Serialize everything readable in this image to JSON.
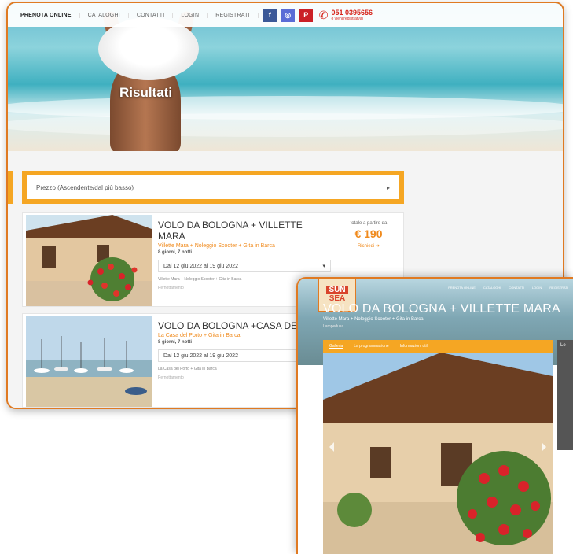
{
  "back_window": {
    "nav_items": [
      "PRENOTA ONLINE",
      "CATALOGHI",
      "CONTATTI",
      "LOGIN",
      "REGISTRATI"
    ],
    "social_icons": [
      {
        "name": "facebook-icon",
        "glyph": "f",
        "color": "#3b5998"
      },
      {
        "name": "instagram-icon",
        "glyph": "◎",
        "color": "#5b6cd6"
      },
      {
        "name": "pinterest-icon",
        "glyph": "P",
        "color": "#cb2027"
      }
    ],
    "phone_number": "051 0395656",
    "phone_note": "o vieni/registrati/al",
    "hero_title": "Risultati",
    "sort_select": "Prezzo (Ascendente/dal più basso)",
    "accent_color": "#f5a623",
    "results": [
      {
        "title": "VOLO DA BOLOGNA + VILLETTE MARA",
        "subtitle": "Villette Mara + Noleggio Scooter + Gita in Barca",
        "duration": "8 giorni, 7 notti",
        "date": "Dal 12 giu 2022 al 19 giu 2022",
        "description": "Villette Mara + Noleggio Scooter + Gita in Barca",
        "footer": "Pernottamento",
        "price_label": "totale a partire da",
        "price": "€ 190",
        "price_link": "Richiedi"
      },
      {
        "title": "VOLO DA BOLOGNA +CASA DEL P",
        "subtitle": "La Casa del Porto + Gita in Barca",
        "duration": "8 giorni, 7 notti",
        "date": "Dal 12 giu 2022 al 19 giu 2022",
        "description": "La Casa del Porto + Gita in Barca",
        "footer": "Pernottamento"
      }
    ]
  },
  "front_window": {
    "logo_top": "SUN",
    "logo_bottom": "SEA",
    "nav_items": [
      "PRENOTA ONLINE",
      "CATALOGHI",
      "CONTATTI",
      "LOGIN",
      "REGISTRATI"
    ],
    "title": "VOLO DA BOLOGNA + VILLETTE MARA",
    "subtitle": "Villette Mara + Noleggio Scooter + Gita in Barca",
    "location": "Lampedusa",
    "tabs": [
      "Galleria",
      "La programmazione",
      "Informazioni utili"
    ],
    "side_label": "Le"
  }
}
